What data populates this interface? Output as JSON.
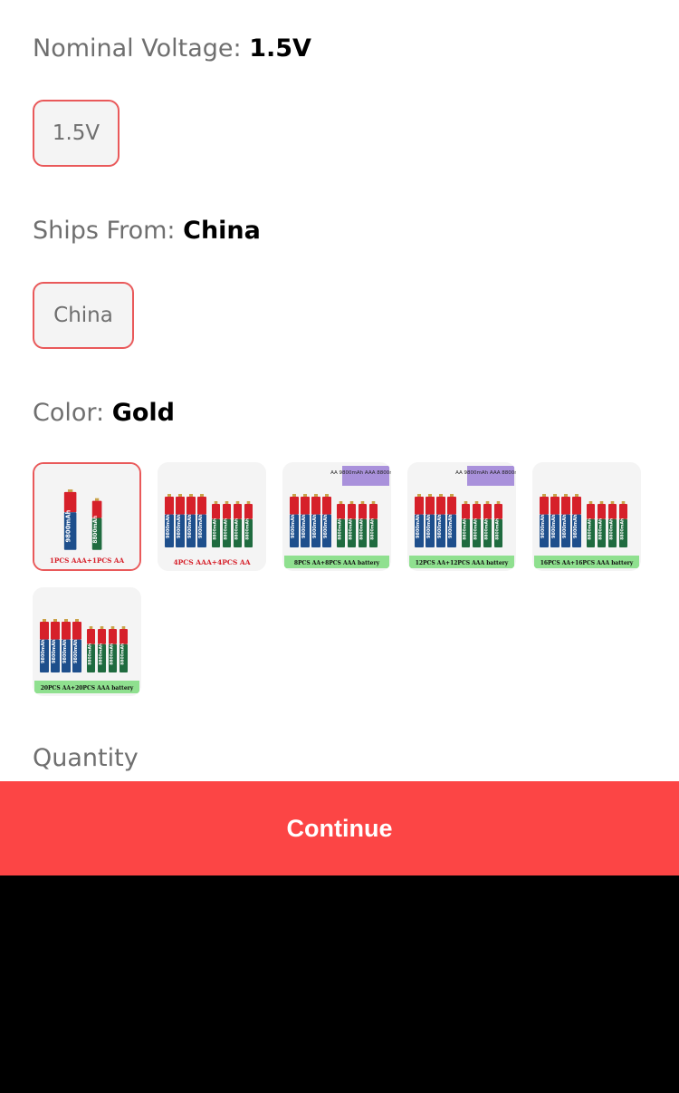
{
  "voltage": {
    "label": "Nominal Voltage: ",
    "value": "1.5V",
    "options": [
      "1.5V"
    ]
  },
  "ships_from": {
    "label": "Ships From: ",
    "value": "China",
    "options": [
      "China"
    ]
  },
  "color": {
    "label": "Color: ",
    "value": "Gold",
    "options": [
      {
        "caption": "1PCS AAA+1PCS AA",
        "aa": 1,
        "aaa": 1,
        "selected": true
      },
      {
        "caption": "4PCS AAA+4PCS AA",
        "aa": 4,
        "aaa": 4,
        "selected": false
      },
      {
        "caption": "8PCS AA+8PCS AAA battery",
        "aa": 4,
        "aaa": 4,
        "selected": false,
        "tag": "AA 9800mAh AAA 8800mAh"
      },
      {
        "caption": "12PCS AA+12PCS AAA battery",
        "aa": 4,
        "aaa": 4,
        "selected": false,
        "tag": "AA 9800mAh AAA 8800mAh"
      },
      {
        "caption": "16PCS AA+16PCS AAA battery",
        "aa": 4,
        "aaa": 4,
        "selected": false
      },
      {
        "caption": "20PCS AA+20PCS AAA battery",
        "aa": 4,
        "aaa": 4,
        "selected": false
      }
    ],
    "battery_labels": {
      "aa": "9800mAh",
      "aaa": "8800mAh"
    }
  },
  "quantity": {
    "label": "Quantity"
  },
  "continue_label": "Continue",
  "colors": {
    "accent": "#fc4545",
    "chip_border": "#e9595a",
    "battery_red": "#d6202a",
    "battery_blue": "#1e4f8c",
    "battery_green": "#1f6b3f"
  }
}
